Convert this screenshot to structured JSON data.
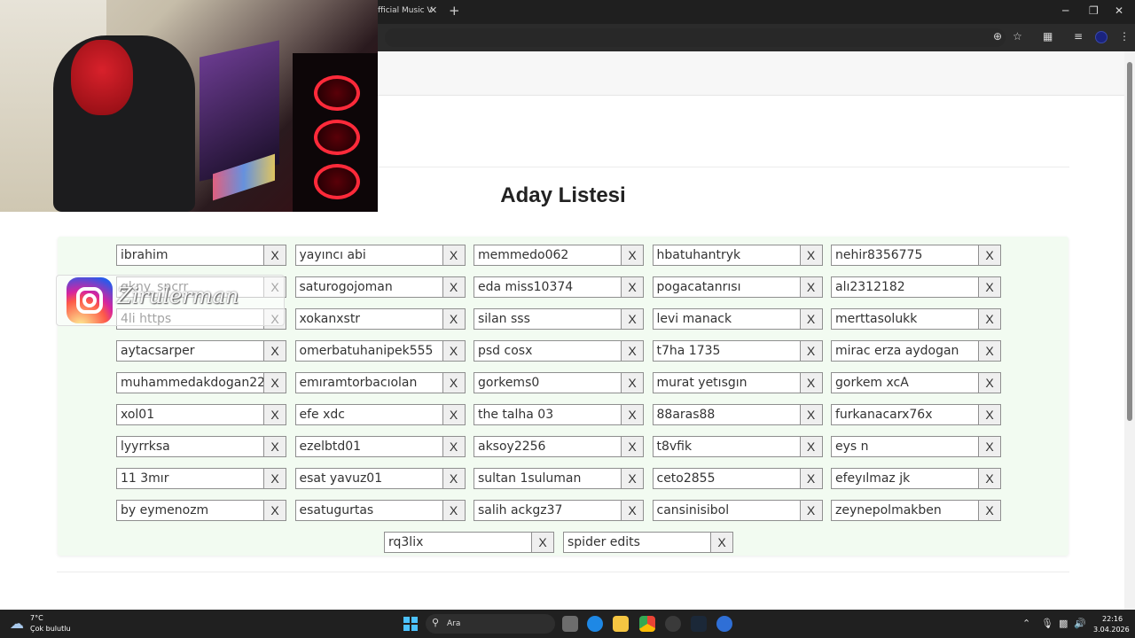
{
  "browser": {
    "tab_title": "fficial Music V",
    "tab_close": "✕",
    "new_tab": "+",
    "window_controls": {
      "minimize": "─",
      "restore": "❐",
      "close": "✕"
    },
    "toolbar_icons": [
      "zoom-icon",
      "bookmark-star-icon",
      "extensions-icon",
      "media-icon",
      "profile-avatar",
      "menu-icon"
    ]
  },
  "page": {
    "title": "Aday Listesi",
    "delete_label": "X",
    "candidates": [
      [
        "ibrahim",
        "yayıncı abi",
        "memmedo062",
        "hbatuhantryk",
        "nehir8356775"
      ],
      [
        "gkny_sncrr",
        "saturogojoman",
        "eda miss10374",
        "pogacatanrısı",
        "alı2312182"
      ],
      [
        "4li https",
        "xokanxstr",
        "silan sss",
        "levi manack",
        "merttasolukk"
      ],
      [
        "aytacsarper",
        "omerbatuhanipek555",
        "psd cosx",
        "t7ha 1735",
        "mirac erza aydogan"
      ],
      [
        "muhammedakdogan22",
        "emıramtorbacıolan",
        "gorkems0",
        "murat yetısgın",
        "gorkem xcA"
      ],
      [
        "xol01",
        "efe xdc",
        "the talha 03",
        "88aras88",
        "furkanacarx76x"
      ],
      [
        "lyyrrksa",
        "ezelbtd01",
        "aksoy2256",
        "t8vfik",
        "eys n"
      ],
      [
        "11 3mır",
        "esat yavuz01",
        "sultan 1suluman",
        "ceto2855",
        "efeyılmaz jk"
      ],
      [
        "by eymenozm",
        "esatugurtas",
        "salih ackgz37",
        "cansinisibol",
        "zeynepolmakben"
      ]
    ],
    "last_row": [
      "rq3lix",
      "spider edits"
    ]
  },
  "overlay": {
    "instagram_handle": "Zirulerman"
  },
  "taskbar": {
    "weather_temp": "7°C",
    "weather_desc": "Çok bulutlu",
    "search_placeholder": "Ara",
    "time": "22:16",
    "date": "3.04.2026"
  },
  "colors": {
    "card_background": "#f2fbf1",
    "chrome_dark": "#1f1f1f",
    "taskbar": "#202020",
    "start_accent": "#4cc2ff"
  }
}
